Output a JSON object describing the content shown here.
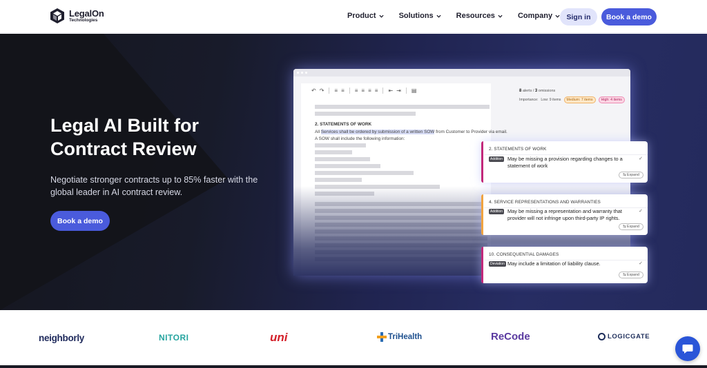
{
  "nav": {
    "logo_name": "LegalOn",
    "logo_sub": "Technologies",
    "menu": [
      "Product",
      "Solutions",
      "Resources",
      "Company"
    ],
    "signin": "Sign in",
    "demo": "Book a demo"
  },
  "hero": {
    "title_line1": "Legal AI Built for",
    "title_line2": "Contract Review",
    "subtitle": "Negotiate stronger contracts up to 85% faster with the global leader in AI contract review.",
    "cta": "Book a demo"
  },
  "mock": {
    "alerts_count": "8",
    "alerts_label": "alerts /",
    "omissions_count": "3",
    "omissions_label": "omissions",
    "importance_label": "Importance:",
    "low": "Low: 9 items",
    "medium": "Medium: 7 items",
    "high": "High: 4 items",
    "doc_heading": "2. STATEMENTS OF WORK",
    "doc_text_pre": "All",
    "doc_text_hl": "Services shall be ordered by submission of a written SOW",
    "doc_text_post": "from Customer to Provider via email. A SOW shall include the following information:"
  },
  "cards": [
    {
      "title": "2. STATEMENTS OF WORK",
      "tag": "Addition",
      "text": "May be missing a provision regarding changes to a statement of work",
      "expand": "Expand",
      "accent": "#c2287a"
    },
    {
      "title": "4. SERVICE REPRESENTATIONS AND WARRANTIES",
      "tag": "Addition",
      "text": "May be missing a representation and warranty that provider will not infringe upon third-party IP rights.",
      "expand": "Expand",
      "accent": "#f0a340"
    },
    {
      "title": "10. CONSEQUENTIAL DAMAGES",
      "tag": "Deviation",
      "text": "May include a limitation of liability clause.",
      "expand": "Expand",
      "accent": "#c2287a"
    }
  ],
  "logos": [
    "neighborly",
    "NITORI",
    "uni",
    "TriHealth",
    "ReCode",
    "LOGICGATE"
  ],
  "colors": {
    "accent": "#4a5bdc",
    "high": "#c2287a",
    "medium": "#f0a340"
  }
}
